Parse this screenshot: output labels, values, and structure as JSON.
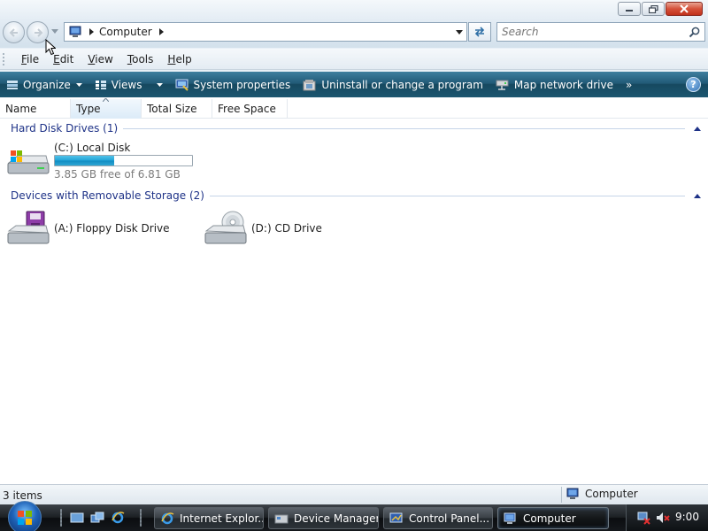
{
  "window": {
    "address": {
      "crumb": "Computer"
    },
    "search": {
      "placeholder": "Search"
    }
  },
  "menubar": {
    "items": [
      {
        "label": "File",
        "accel": "F",
        "rest": "ile"
      },
      {
        "label": "Edit",
        "accel": "E",
        "rest": "dit"
      },
      {
        "label": "View",
        "accel": "V",
        "rest": "iew"
      },
      {
        "label": "Tools",
        "accel": "T",
        "rest": "ools"
      },
      {
        "label": "Help",
        "accel": "H",
        "rest": "elp"
      }
    ]
  },
  "commandbar": {
    "organize": "Organize",
    "views": "Views",
    "system_properties": "System properties",
    "uninstall": "Uninstall or change a program",
    "map_drive": "Map network drive",
    "more": "»",
    "help": "?"
  },
  "columns": [
    "Name",
    "Type",
    "Total Size",
    "Free Space"
  ],
  "groups": {
    "hard_disks": {
      "title": "Hard Disk Drives (1)",
      "drives": [
        {
          "name": "(C:) Local Disk",
          "free_text": "3.85 GB free of 6.81 GB",
          "used_fraction": 0.435
        }
      ]
    },
    "removable": {
      "title": "Devices with Removable Storage (2)",
      "drives": [
        {
          "name": "(A:) Floppy Disk Drive"
        },
        {
          "name": "(D:) CD Drive"
        }
      ]
    }
  },
  "statusbar": {
    "items": "3 items",
    "location": "Computer"
  },
  "taskbar": {
    "tasks": [
      {
        "label": "Internet Explor..."
      },
      {
        "label": "Device Manager"
      },
      {
        "label": "Control Panel..."
      },
      {
        "label": "Computer"
      }
    ],
    "clock": "9:00"
  },
  "colors": {
    "accent": "#1c5670",
    "group_heading": "#1e3287",
    "progress": "#21a3d6"
  }
}
